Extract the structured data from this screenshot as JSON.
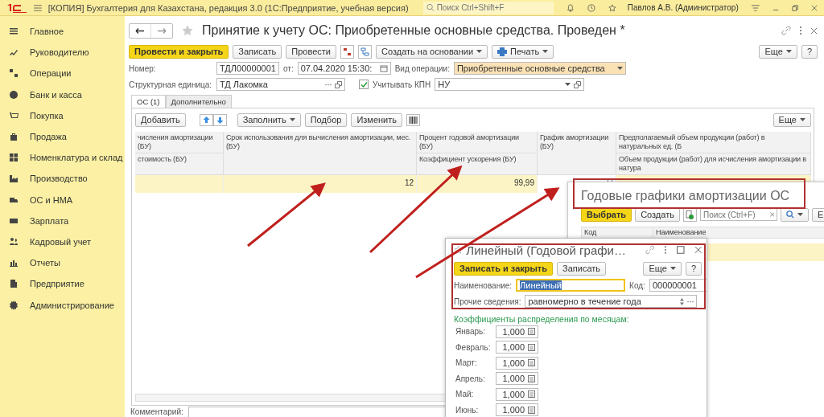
{
  "app_bar": {
    "title": "[КОПИЯ] Бухгалтерия для Казахстана, редакция 3.0  (1С:Предприятие, учебная версия)",
    "search_placeholder": "Поиск Ctrl+Shift+F",
    "user": "Павлов А.В. (Администратор)"
  },
  "sidebar": {
    "items": [
      {
        "label": "Главное"
      },
      {
        "label": "Руководителю"
      },
      {
        "label": "Операции"
      },
      {
        "label": "Банк и касса"
      },
      {
        "label": "Покупка"
      },
      {
        "label": "Продажа"
      },
      {
        "label": "Номенклатура и склад"
      },
      {
        "label": "Производство"
      },
      {
        "label": "ОС и НМА"
      },
      {
        "label": "Зарплата"
      },
      {
        "label": "Кадровый учет"
      },
      {
        "label": "Отчеты"
      },
      {
        "label": "Предприятие"
      },
      {
        "label": "Администрирование"
      }
    ]
  },
  "document": {
    "title": "Принятие к учету ОС: Приобретенные основные средства. Проведен *",
    "toolbar": [
      {
        "label": "Провести и закрыть",
        "kind": "primary"
      },
      {
        "label": "Записать",
        "kind": "plain"
      },
      {
        "label": "Провести",
        "kind": "plain"
      },
      {
        "kind": "icons"
      },
      {
        "label": "Создать на основании",
        "kind": "menu"
      },
      {
        "label": "Печать",
        "kind": "print"
      }
    ],
    "more": "Еще",
    "help": "?",
    "number_label": "Номер:",
    "number": "ТДЛ00000001",
    "date_label": "от:",
    "date": "07.04.2020 15:30:",
    "operation_label": "Вид операции:",
    "operation": "Приобретенные основные средства",
    "unit_label": "Структурная единица:",
    "unit": "ТД Лакомка",
    "kpn": {
      "label": "Учитывать КПН",
      "checked": true
    },
    "kpn_value": "НУ",
    "tabs": [
      {
        "label": "ОС (1)",
        "selected": true
      },
      {
        "label": "Дополнительно",
        "selected": false
      }
    ],
    "table_toolbar": {
      "add": "Добавить",
      "fill": "Заполнить",
      "pick": "Подбор",
      "change": "Изменить",
      "more": "Еще"
    },
    "table": {
      "columns": [
        {
          "top": "числения амортизации (БУ)",
          "bottom": "стоимость (БУ)",
          "kind": "text"
        },
        {
          "top": "Срок использования для вычисления амортизации, мес. (БУ)",
          "kind": "text"
        },
        {
          "top": "Процент годовой амортизации (БУ)",
          "bottom": "Коэффициент ускорения (БУ)",
          "kind": "text"
        },
        {
          "top": "График амортизации (БУ)",
          "kind": "select"
        },
        {
          "top": "Предполагаемый объем продукции (работ) в натуральных ед. (Б",
          "bottom": "Объем продукции (работ) для исчисления амортизации в натура",
          "kind": "text"
        }
      ],
      "rows": [
        {
          "selected": true,
          "cells": [
            "",
            "12",
            "99,99",
            "",
            ""
          ]
        }
      ]
    },
    "comment_label": "Комментарий:"
  },
  "schedules_window": {
    "title": "Годовые графики амортизации ОС",
    "choose": "Выбрать",
    "create": "Создать",
    "search_placeholder": "Поиск (Ctrl+F)",
    "more": "Е",
    "columns": [
      "Код",
      "Наименование"
    ]
  },
  "item_window": {
    "title": "Линейный (Годовой графи…",
    "save_close": "Записать и закрыть",
    "save": "Записать",
    "more": "Еще",
    "help": "?",
    "name_label": "Наименование:",
    "name": "Линейный",
    "code_label": "Код:",
    "code": "000000001",
    "other_label": "Прочие сведения:",
    "other": "равномерно в течение года",
    "section": "Коэффициенты распределения по месяцам:",
    "months": [
      {
        "label": "Январь:",
        "value": "1,000"
      },
      {
        "label": "Февраль:",
        "value": "1,000"
      },
      {
        "label": "Март:",
        "value": "1,000"
      },
      {
        "label": "Апрель:",
        "value": "1,000"
      },
      {
        "label": "Май:",
        "value": "1,000"
      },
      {
        "label": "Июнь:",
        "value": "1,000"
      }
    ]
  }
}
